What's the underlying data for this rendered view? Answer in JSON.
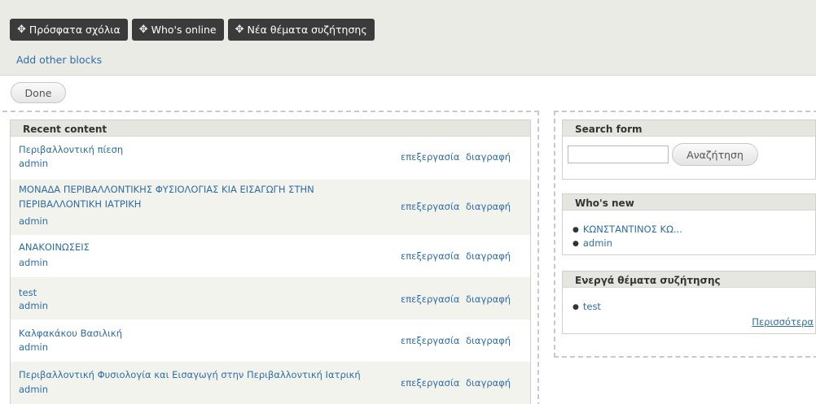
{
  "tray": {
    "buttons": [
      {
        "icon": "move-icon",
        "label": "Πρόσφατα σχόλια"
      },
      {
        "icon": "move-icon",
        "label": "Who's online"
      },
      {
        "icon": "move-icon",
        "label": "Νέα θέματα συζήτησης"
      }
    ],
    "add_link": "Add other blocks"
  },
  "done_label": "Done",
  "recent_content": {
    "title": "Recent content",
    "rows": [
      {
        "title": "Περιβαλλοντική πίεση",
        "author": "admin",
        "edit": "επεξεργασία",
        "delete": "διαγραφή"
      },
      {
        "title": "ΜΟΝΑΔΑ ΠΕΡΙΒΑΛΛΟΝΤΙΚΗΣ ΦΥΣΙΟΛΟΓΙΑΣ ΚΙΑ ΕΙΣΑΓΩΓΗ ΣΤΗΝ ΠΕΡΙΒΑΛΛΟΝΤΙΚΗ ΙΑΤΡΙΚΗ",
        "author": "admin",
        "edit": "επεξεργασία",
        "delete": "διαγραφή"
      },
      {
        "title": "ΑΝΑΚΟΙΝΩΣΕΙΣ",
        "author": "admin",
        "edit": "επεξεργασία",
        "delete": "διαγραφή"
      },
      {
        "title": "test",
        "author": "admin",
        "edit": "επεξεργασία",
        "delete": "διαγραφή"
      },
      {
        "title": "Καλφακάκου Βασιλική",
        "author": "admin",
        "edit": "επεξεργασία",
        "delete": "διαγραφή"
      },
      {
        "title": "Περιβαλλοντική Φυσιολογία και Εισαγωγή στην Περιβαλλοντική Ιατρική",
        "author": "admin",
        "edit": "επεξεργασία",
        "delete": "διαγραφή"
      }
    ]
  },
  "search_block": {
    "title": "Search form",
    "input_value": "",
    "button_label": "Αναζήτηση"
  },
  "whos_new": {
    "title": "Who's new",
    "items": [
      "ΚΩΝΣΤΑΝΤΙΝΟΣ ΚΩ...",
      "admin"
    ]
  },
  "active_forum": {
    "title": "Ενεργά θέματα συζήτησης",
    "items": [
      "test"
    ],
    "more": "Περισσότερα"
  }
}
